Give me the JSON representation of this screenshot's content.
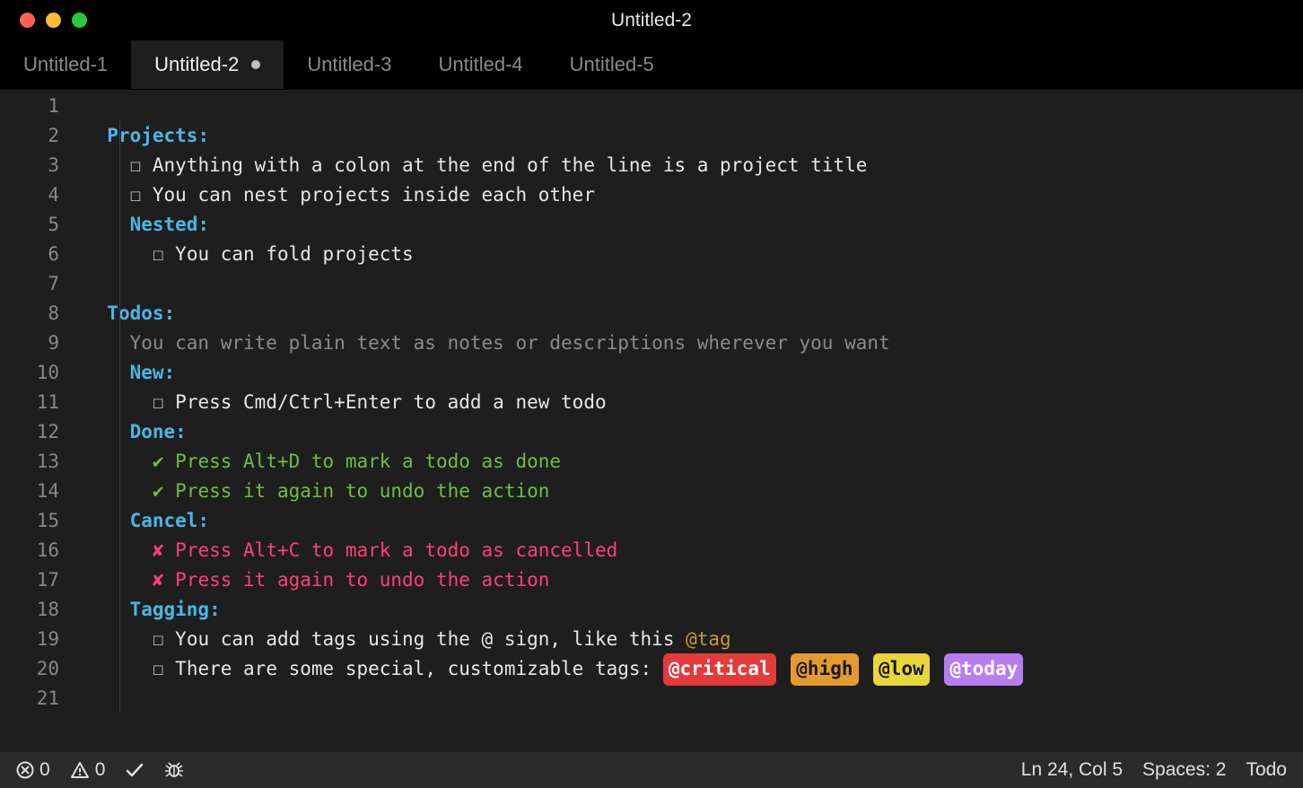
{
  "window": {
    "title": "Untitled-2"
  },
  "tabs": [
    {
      "label": "Untitled-1",
      "active": false,
      "dirty": false
    },
    {
      "label": "Untitled-2",
      "active": true,
      "dirty": true
    },
    {
      "label": "Untitled-3",
      "active": false,
      "dirty": false
    },
    {
      "label": "Untitled-4",
      "active": false,
      "dirty": false
    },
    {
      "label": "Untitled-5",
      "active": false,
      "dirty": false
    }
  ],
  "lines": {
    "count": 21,
    "l2": "Projects:",
    "l3": "Anything with a colon at the end of the line is a project title",
    "l4": "You can nest projects inside each other",
    "l5": "Nested:",
    "l6": "You can fold projects",
    "l8": "Todos:",
    "l9": "You can write plain text as notes or descriptions wherever you want",
    "l10": "New:",
    "l11": "Press Cmd/Ctrl+Enter to add a new todo",
    "l12": "Done:",
    "l13": "Press Alt+D to mark a todo as done",
    "l14": "Press it again to undo the action",
    "l15": "Cancel:",
    "l16": "Press Alt+C to mark a todo as cancelled",
    "l17": "Press it again to undo the action",
    "l18": "Tagging:",
    "l19a": "You can add tags using the @ sign, like this ",
    "l19b": "@tag",
    "l20a": "There are some special, customizable tags: ",
    "tags": {
      "critical": "@critical",
      "high": "@high",
      "low": "@low",
      "today": "@today"
    }
  },
  "glyphs": {
    "box": "☐",
    "check": "✔",
    "cross": "✘"
  },
  "status": {
    "errors": "0",
    "warnings": "0",
    "cursor": "Ln 24, Col 5",
    "indent": "Spaces: 2",
    "lang": "Todo"
  }
}
